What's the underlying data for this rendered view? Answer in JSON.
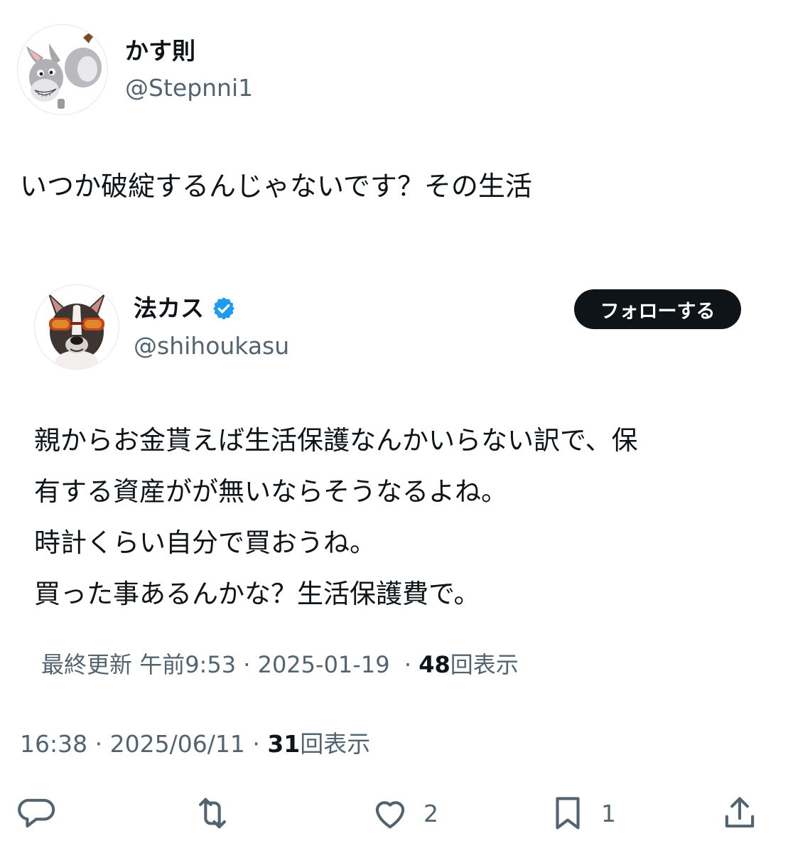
{
  "author": {
    "name": "かす則",
    "handle": "@Stepnni1",
    "avatar_icon": "donkey-icon"
  },
  "tweet": {
    "text": "いつか破綻するんじゃないです？その生活",
    "time": "16:38",
    "date": "2025/06/11",
    "views_count": "31",
    "views_label": "回表示",
    "separator": "·"
  },
  "quote": {
    "name": "法カス",
    "handle": "@shihoukasu",
    "avatar_icon": "french-bulldog-sunglasses-icon",
    "verified_color": "#1d9bf0",
    "follow_label": "フォローする",
    "body_lines": [
      "親からお金貰えば生活保護なんかいらない訳で、保",
      "有する資産がが無いならそうなるよね。",
      "時計くらい自分で買おうね。",
      "買った事あるんかな？生活保護費で。"
    ],
    "updated_label": "最終更新",
    "updated_time": "午前9:53",
    "updated_date": "2025-01-19",
    "views_count": "48",
    "views_label": "回表示",
    "separator": "·"
  },
  "actions": {
    "reply_icon": "reply-bubble-icon",
    "retweet_icon": "retweet-icon",
    "like_icon": "heart-icon",
    "like_count": "2",
    "bookmark_icon": "bookmark-icon",
    "bookmark_count": "1",
    "share_icon": "share-upload-icon"
  }
}
